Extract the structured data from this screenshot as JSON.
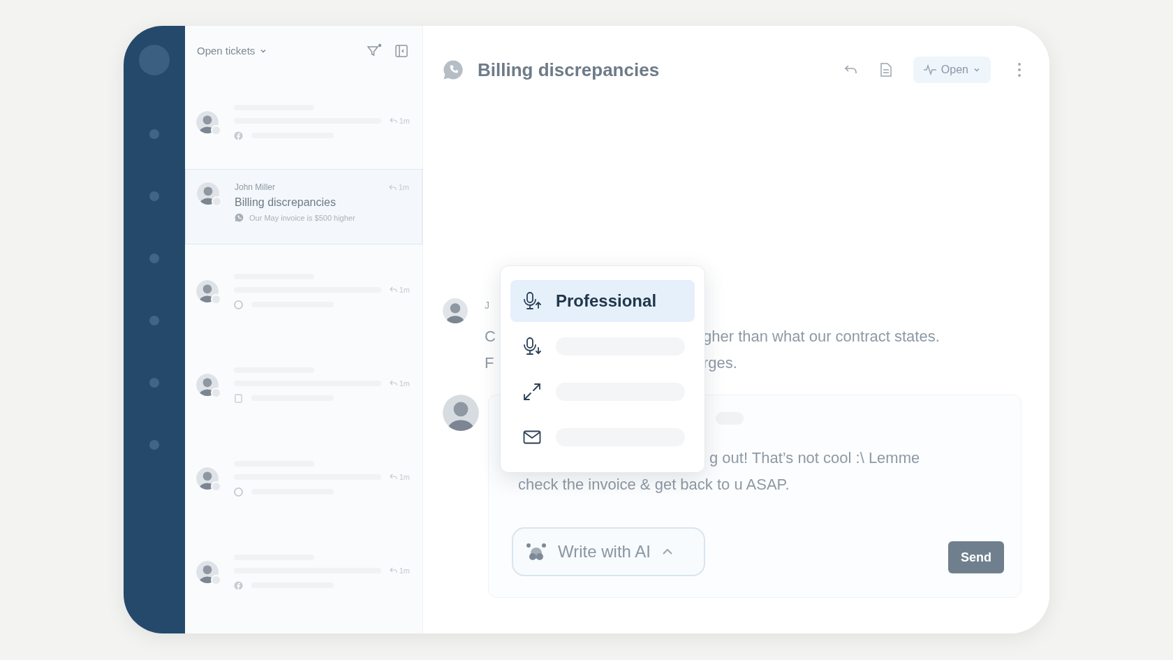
{
  "ticket_list": {
    "title": "Open tickets",
    "tickets": [
      {
        "kind": "placeholder",
        "time": "1m",
        "selected": false
      },
      {
        "kind": "ticket",
        "name": "John Miller",
        "subject": "Billing discrepancies",
        "preview": "Our May invoice is $500 higher",
        "time": "1m",
        "selected": true
      },
      {
        "kind": "placeholder",
        "time": "1m",
        "selected": false
      },
      {
        "kind": "placeholder",
        "time": "1m",
        "selected": false
      },
      {
        "kind": "placeholder",
        "time": "1m",
        "selected": false
      },
      {
        "kind": "placeholder",
        "time": "1m",
        "selected": false
      }
    ]
  },
  "conversation": {
    "title": "Billing discrepancies",
    "status": "Open",
    "messages": [
      {
        "kind": "customer",
        "author": "J",
        "lines": [
          {
            "left": "C",
            "right": "gher than what our contract states."
          },
          {
            "left": "F",
            "right": "rges."
          }
        ]
      },
      {
        "kind": "agent",
        "lines": [
          {
            "right": "g out! That’s not cool :\\ Lemme"
          },
          {
            "left": "check the invoice & get back to u ASAP."
          }
        ]
      }
    ],
    "composer": {
      "ai_button": "Write with AI",
      "send": "Send"
    },
    "tone_menu": {
      "items": [
        {
          "kind": "option",
          "label": "Professional",
          "selected": true
        },
        {
          "kind": "placeholder",
          "selected": false
        },
        {
          "kind": "placeholder",
          "selected": false
        },
        {
          "kind": "placeholder",
          "selected": false
        }
      ]
    }
  }
}
